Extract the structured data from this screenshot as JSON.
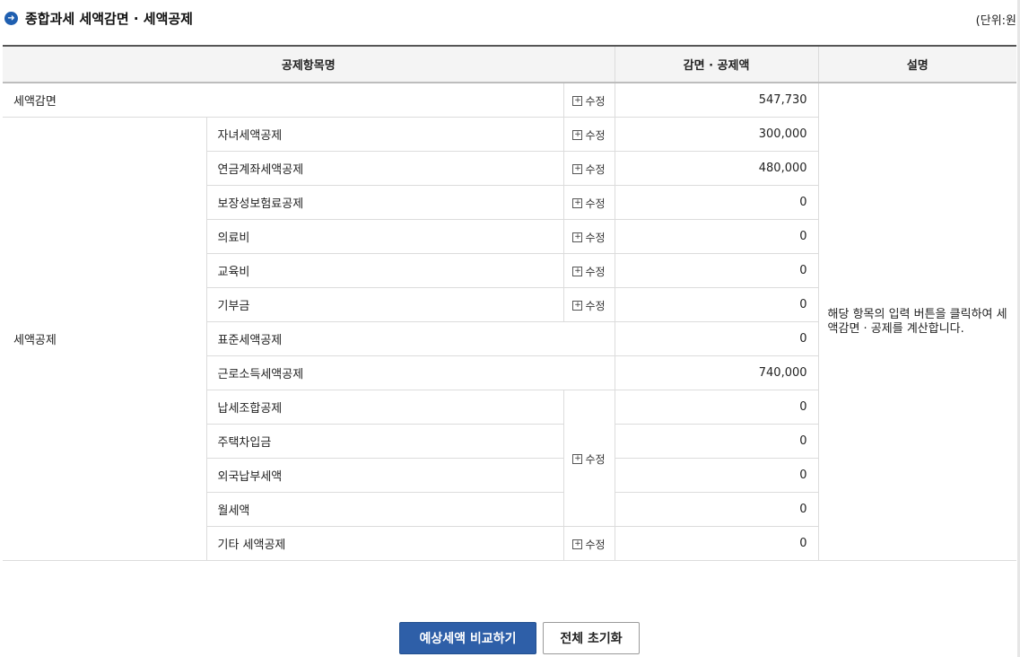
{
  "header": {
    "title": "종합과세 세액감면 · 세액공제",
    "unit": "(단위:원"
  },
  "table": {
    "columns": {
      "item": "공제항목명",
      "amount": "감면 · 공제액",
      "description": "설명"
    },
    "edit_label": "수정",
    "reduction": {
      "label": "세액감면",
      "amount": "547,730"
    },
    "deduction_group_label": "세액공제",
    "description_text": "해당 항목의 입력 버튼을 클릭하여 세액감면 · 공제를 계산합니다.",
    "rows": [
      {
        "label": "자녀세액공제",
        "amount": "300,000"
      },
      {
        "label": "연금계좌세액공제",
        "amount": "480,000"
      },
      {
        "label": "보장성보험료공제",
        "amount": "0"
      },
      {
        "label": "의료비",
        "amount": "0"
      },
      {
        "label": "교육비",
        "amount": "0"
      },
      {
        "label": "기부금",
        "amount": "0"
      },
      {
        "label": "표준세액공제",
        "amount": "0"
      },
      {
        "label": "근로소득세액공제",
        "amount": "740,000"
      },
      {
        "label": "납세조합공제",
        "amount": "0"
      },
      {
        "label": "주택차입금",
        "amount": "0"
      },
      {
        "label": "외국납부세액",
        "amount": "0"
      },
      {
        "label": "월세액",
        "amount": "0"
      },
      {
        "label": "기타 세액공제",
        "amount": "0"
      }
    ]
  },
  "actions": {
    "compare_label": "예상세액 비교하기",
    "reset_label": "전체 초기화"
  },
  "colors": {
    "primary": "#2e5fa8",
    "title_icon": "#1f5fb0"
  }
}
